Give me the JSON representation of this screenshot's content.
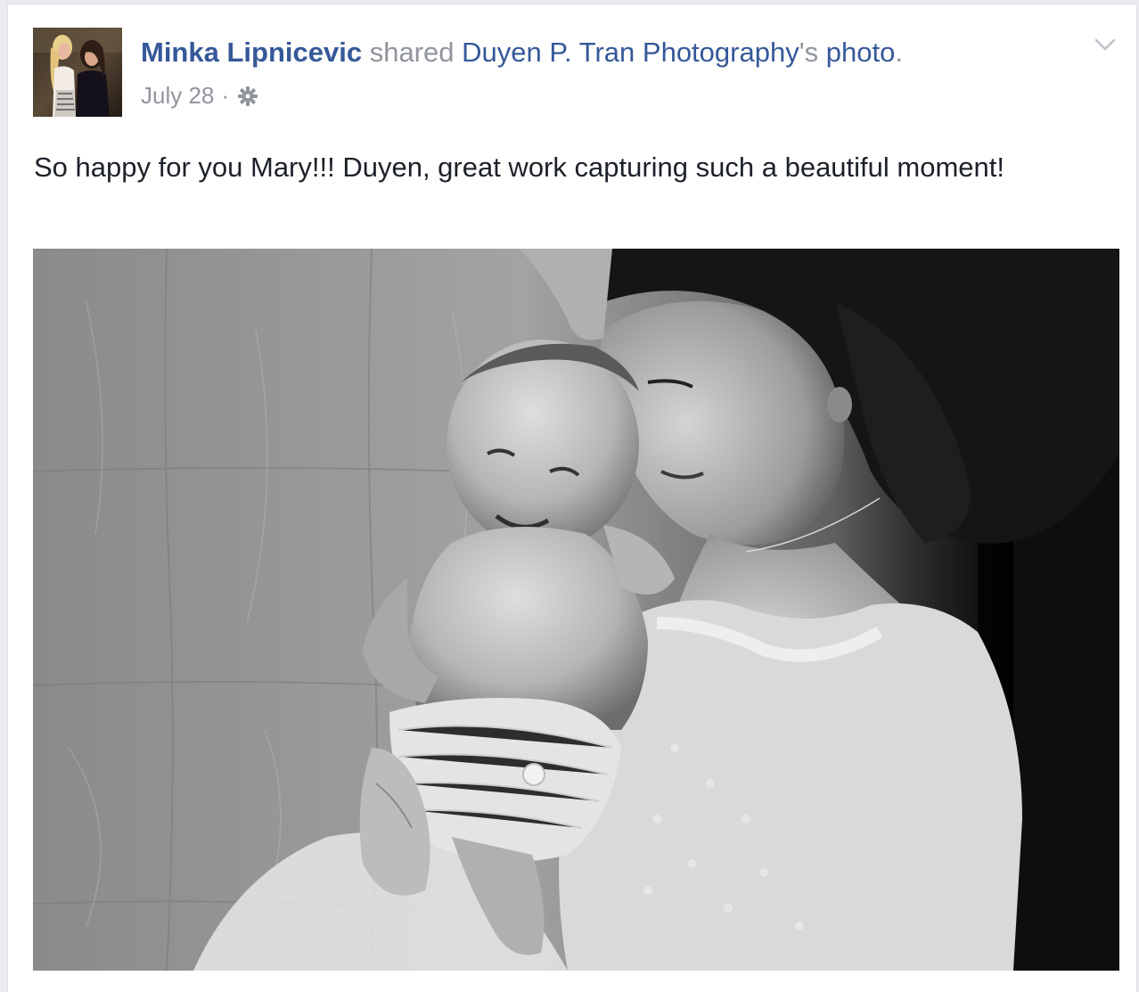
{
  "post": {
    "actor_name": "Minka Lipnicevic",
    "verb": "shared",
    "page_name": "Duyen P. Tran Photography",
    "possessive": "'s",
    "object_link": "photo",
    "period": ".",
    "timestamp": "July 28",
    "separator": "·",
    "privacy_icon": "gear-icon",
    "menu_icon": "chevron-down-icon",
    "message": "So happy for you Mary!!! Duyen, great work capturing such a beautiful moment!"
  },
  "colors": {
    "link": "#365899",
    "meta_text": "#90949c",
    "body_text": "#1d2129"
  }
}
